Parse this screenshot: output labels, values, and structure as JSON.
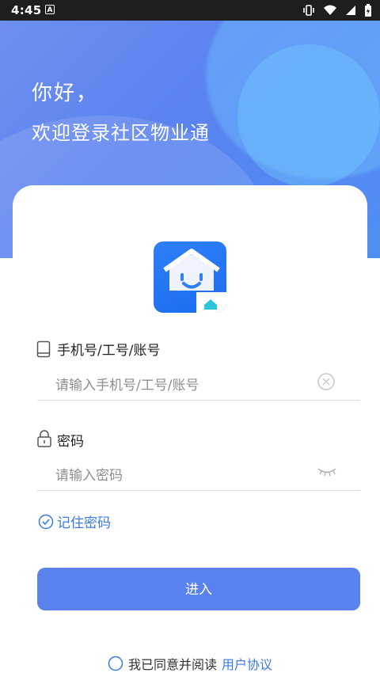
{
  "status_bar": {
    "time": "4:45",
    "notif_letter": "A"
  },
  "hero": {
    "greeting": "你好，",
    "welcome": "欢迎登录社区物业通"
  },
  "account": {
    "label": "手机号/工号/账号",
    "placeholder": "请输入手机号/工号/账号"
  },
  "password": {
    "label": "密码",
    "placeholder": "请输入密码"
  },
  "remember_label": "记住密码",
  "submit_label": "进入",
  "agreement": {
    "prefix": "我已同意并阅读",
    "link": "用户协议"
  },
  "colors": {
    "primary": "#5a82ef",
    "accent": "#3a7ae6",
    "statusbar": "#1e1e1e"
  }
}
